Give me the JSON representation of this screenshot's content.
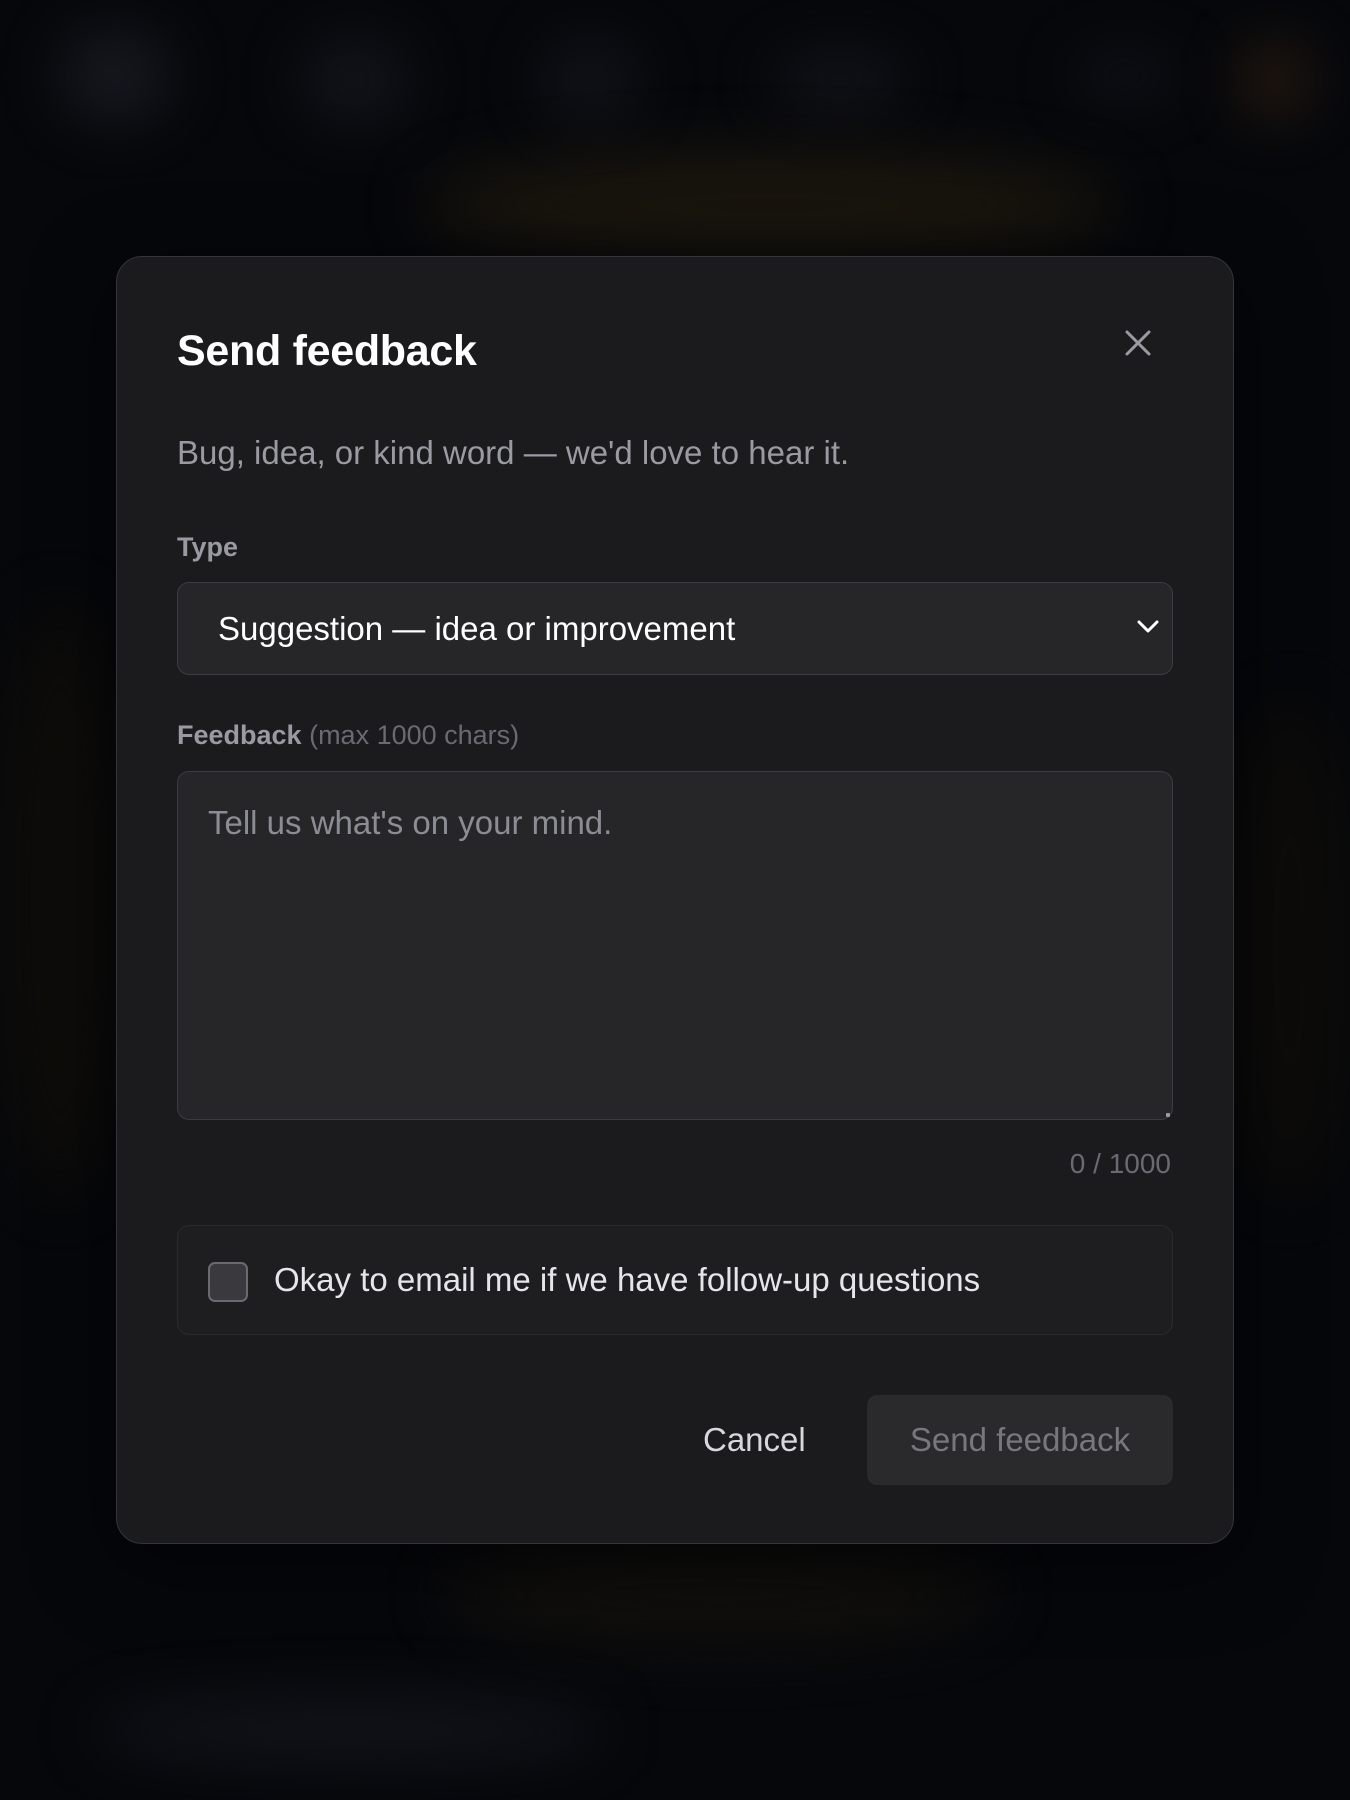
{
  "modal": {
    "title": "Send feedback",
    "subtitle": "Bug, idea, or kind word — we'd love to hear it.",
    "close_icon": "close-icon"
  },
  "type_field": {
    "label": "Type",
    "selected": "Suggestion — idea or improvement",
    "chevron_icon": "chevron-down-icon"
  },
  "feedback_field": {
    "label": "Feedback",
    "hint": "(max 1000 chars)",
    "placeholder": "Tell us what's on your mind.",
    "value": "",
    "counter": "0 / 1000"
  },
  "consent": {
    "label": "Okay to email me if we have follow-up questions",
    "checked": false
  },
  "actions": {
    "cancel_label": "Cancel",
    "submit_label": "Send feedback"
  },
  "colors": {
    "modal_bg": "#1b1b1d",
    "field_bg": "#262628",
    "title": "#ffffff",
    "muted": "#9a9aa2",
    "submit_disabled_bg": "#2a2a2c",
    "submit_disabled_text": "#77777e"
  }
}
